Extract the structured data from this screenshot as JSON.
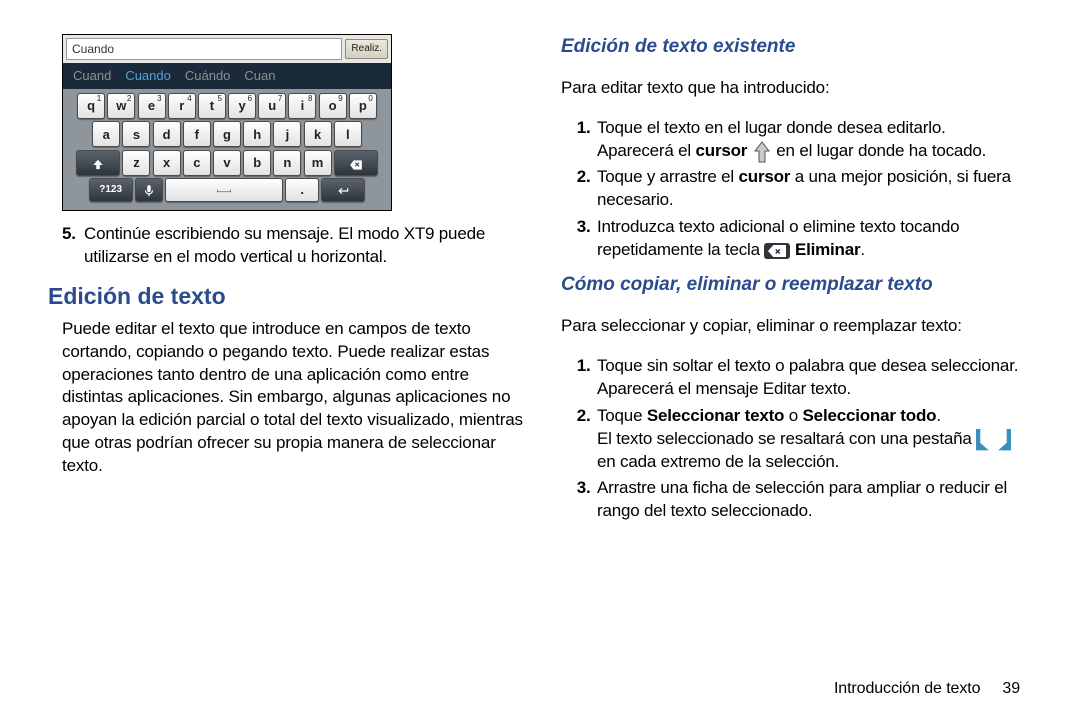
{
  "screenshot": {
    "input_value": "Cuando",
    "done_label": "Realiz.",
    "suggestions": [
      "Cuand",
      "Cuando",
      "Cuándo",
      "Cuan"
    ],
    "row1": [
      "q",
      "w",
      "e",
      "r",
      "t",
      "y",
      "u",
      "i",
      "o",
      "p"
    ],
    "sup1": [
      "1",
      "2",
      "3",
      "4",
      "5",
      "6",
      "7",
      "8",
      "9",
      "0"
    ],
    "row2": [
      "a",
      "s",
      "d",
      "f",
      "g",
      "h",
      "j",
      "k",
      "l"
    ],
    "row3": [
      "z",
      "x",
      "c",
      "v",
      "b",
      "n",
      "m"
    ],
    "sym_label": "?123",
    "period": "."
  },
  "left": {
    "step5_num": "5.",
    "step5a": "Continúe escribiendo su mensaje. El modo XT9 puede",
    "step5b": "utilizarse en el modo vertical u horizontal.",
    "h_edit": "Edición de texto",
    "p_edit": "Puede editar el texto que introduce en campos de texto cortando, copiando o pegando texto. Puede realizar estas operaciones tanto dentro de una aplicación como entre distintas aplicaciones. Sin embargo, algunas aplicaciones no apoyan la edición parcial o total del texto visualizado, mientras que otras podrían ofrecer su propia manera de seleccionar texto."
  },
  "right": {
    "h_exist": "Edición de texto existente",
    "intro_exist": "Para editar texto que ha introducido:",
    "s1": "Toque el texto en el lugar donde desea editarlo.",
    "s1b_pre": "Aparecerá el ",
    "s1b_cursor": "cursor",
    "s1b_post": " en el lugar donde ha tocado.",
    "s2_pre": "Toque y arrastre el ",
    "s2_cursor": "cursor",
    "s2_post": " a una mejor posición, si fuera necesario.",
    "s3_pre": "Introduzca texto adicional o elimine texto tocando repetidamente la tecla ",
    "s3_del": " Eliminar",
    "s3_post": ".",
    "h_copy": "Cómo copiar, eliminar o reemplazar texto",
    "intro_copy": "Para seleccionar y copiar, eliminar o reemplazar texto:",
    "c1a": "Toque sin soltar el texto o palabra que desea seleccionar.",
    "c1b": "Aparecerá el mensaje Editar texto.",
    "c2_pre": "Toque ",
    "c2_a": "Seleccionar texto",
    "c2_or": " o ",
    "c2_b": "Seleccionar todo",
    "c2_post": ".",
    "c2_line2_pre": "El texto seleccionado se resaltará con una pestaña ",
    "c2_line3": "en cada extremo de la selección.",
    "c3": "Arrastre una ficha de selección para ampliar o reducir el rango del texto seleccionado."
  },
  "footer": {
    "section": "Introducción de texto",
    "page": "39"
  }
}
